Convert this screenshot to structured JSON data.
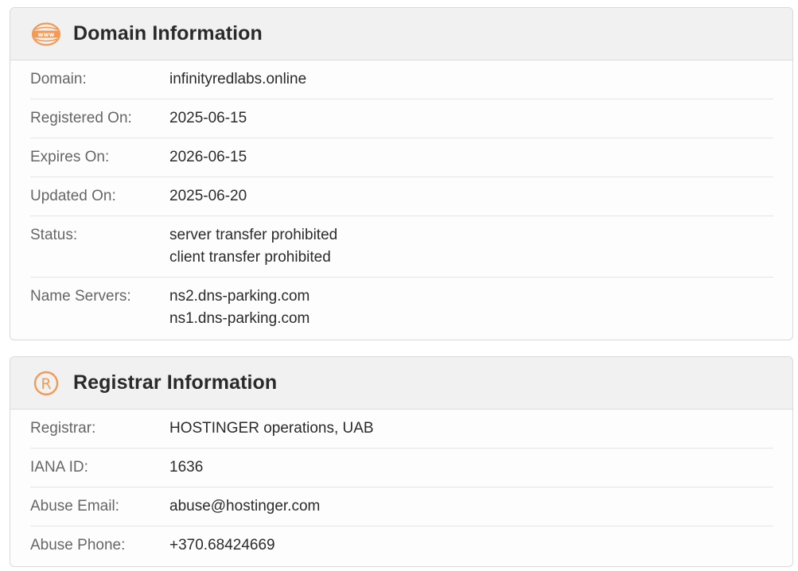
{
  "colors": {
    "accent": "#f29a57",
    "header_bg": "#f1f1f1",
    "label": "#666666",
    "value": "#2b2b2b"
  },
  "domain_card": {
    "icon": "www-globe-icon",
    "title": "Domain Information",
    "rows": [
      {
        "label": "Domain:",
        "values": [
          "infinityredlabs.online"
        ]
      },
      {
        "label": "Registered On:",
        "values": [
          "2025-06-15"
        ]
      },
      {
        "label": "Expires On:",
        "values": [
          "2026-06-15"
        ]
      },
      {
        "label": "Updated On:",
        "values": [
          "2025-06-20"
        ]
      },
      {
        "label": "Status:",
        "values": [
          "server transfer prohibited",
          "client transfer prohibited"
        ]
      },
      {
        "label": "Name Servers:",
        "values": [
          "ns2.dns-parking.com",
          "ns1.dns-parking.com"
        ]
      }
    ]
  },
  "registrar_card": {
    "icon": "registered-mark-icon",
    "title": "Registrar Information",
    "rows": [
      {
        "label": "Registrar:",
        "values": [
          "HOSTINGER operations, UAB"
        ]
      },
      {
        "label": "IANA ID:",
        "values": [
          "1636"
        ]
      },
      {
        "label": "Abuse Email:",
        "values": [
          "abuse@hostinger.com"
        ]
      },
      {
        "label": "Abuse Phone:",
        "values": [
          "+370.68424669"
        ]
      }
    ]
  }
}
